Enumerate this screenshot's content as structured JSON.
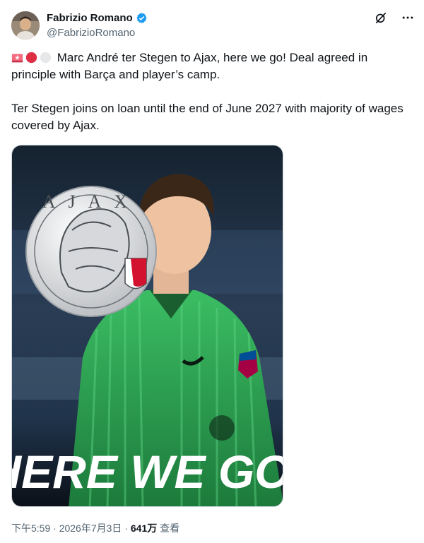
{
  "author": {
    "display_name": "Fabrizio Romano",
    "handle": "@FabrizioRomano",
    "avatar_icon": "avatar-photo",
    "verified_icon": "verified-badge-icon"
  },
  "actions": {
    "grok_icon": "grok-icon",
    "more_icon": "more-icon",
    "more_label": "···"
  },
  "tweet": {
    "emojis": [
      "siren-emoji",
      "red-circle-emoji",
      "white-circle-emoji"
    ],
    "line1": "Marc André ter Stegen to Ajax, here we go! Deal agreed in principle with Barça and player’s camp.",
    "line2": "Ter Stegen joins on loan until the end of June 2027 with majority of wages covered by Ajax."
  },
  "media": {
    "overlay_text": "HERE WE GO",
    "logo_text": "AJAX",
    "colors": {
      "kit": "#2fae56",
      "background": "#1e2b3a",
      "ajax_red": "#d2122e"
    }
  },
  "meta": {
    "time": "下午5:59",
    "separator": "·",
    "date": "2026年7月3日",
    "views_count": "641万",
    "views_label": "查看"
  }
}
